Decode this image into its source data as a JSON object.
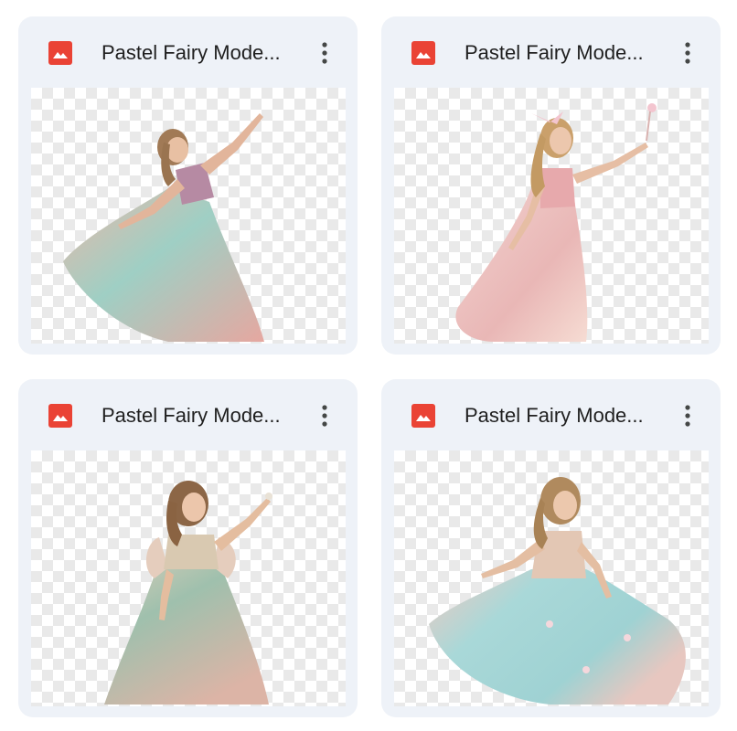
{
  "files": [
    {
      "title": "Pastel Fairy Mode...",
      "icon": "image-file-icon",
      "more_icon": "more-vert-icon"
    },
    {
      "title": "Pastel Fairy Mode...",
      "icon": "image-file-icon",
      "more_icon": "more-vert-icon"
    },
    {
      "title": "Pastel Fairy Mode...",
      "icon": "image-file-icon",
      "more_icon": "more-vert-icon"
    },
    {
      "title": "Pastel Fairy Mode...",
      "icon": "image-file-icon",
      "more_icon": "more-vert-icon"
    }
  ],
  "colors": {
    "card_background": "#eef2f8",
    "file_icon": "#ea4335",
    "title_text": "#1f1f1f"
  }
}
